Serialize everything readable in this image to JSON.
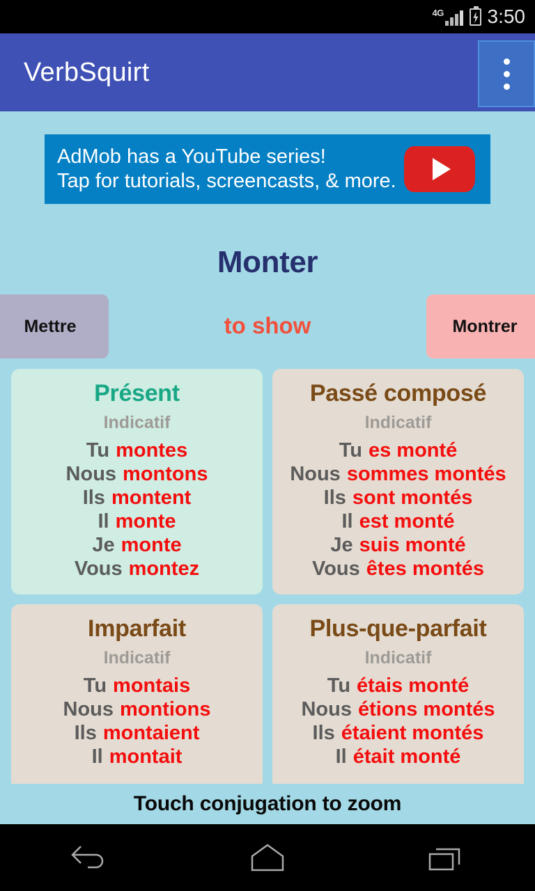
{
  "status_bar": {
    "network": "4G",
    "battery_icon": "battery-charging-icon",
    "time": "3:50"
  },
  "app_bar": {
    "title": "VerbSquirt",
    "overflow_icon": "overflow-menu-icon",
    "background_color": "#3F51B5"
  },
  "ad": {
    "line1": "AdMob has a YouTube series!",
    "line2": "Tap for tutorials, screencasts, & more.",
    "logo_icon": "youtube-play-icon",
    "background_color": "#0580C4"
  },
  "verb": {
    "infinitive": "Monter",
    "translation": "to show",
    "prev_label": "Mettre",
    "next_label": "Montrer",
    "infinitive_color": "#26306E",
    "translation_color": "#F2503C"
  },
  "cards": [
    {
      "title": "Présent",
      "mood": "Indicatif",
      "theme": "mint",
      "title_color": "#18A785",
      "rows": [
        {
          "pronoun": "Tu",
          "form": "montes"
        },
        {
          "pronoun": "Nous",
          "form": "montons"
        },
        {
          "pronoun": "Ils",
          "form": "montent"
        },
        {
          "pronoun": "Il",
          "form": "monte"
        },
        {
          "pronoun": "Je",
          "form": "monte"
        },
        {
          "pronoun": "Vous",
          "form": "montez"
        }
      ]
    },
    {
      "title": "Passé composé",
      "mood": "Indicatif",
      "theme": "beige",
      "title_color": "#7A4A17",
      "rows": [
        {
          "pronoun": "Tu",
          "form": "es monté"
        },
        {
          "pronoun": "Nous",
          "form": "sommes montés"
        },
        {
          "pronoun": "Ils",
          "form": "sont montés"
        },
        {
          "pronoun": "Il",
          "form": "est monté"
        },
        {
          "pronoun": "Je",
          "form": "suis monté"
        },
        {
          "pronoun": "Vous",
          "form": "êtes montés"
        }
      ]
    },
    {
      "title": "Imparfait",
      "mood": "Indicatif",
      "theme": "beige",
      "title_color": "#7A4A17",
      "rows": [
        {
          "pronoun": "Tu",
          "form": "montais"
        },
        {
          "pronoun": "Nous",
          "form": "montions"
        },
        {
          "pronoun": "Ils",
          "form": "montaient"
        },
        {
          "pronoun": "Il",
          "form": "montait"
        }
      ]
    },
    {
      "title": "Plus-que-parfait",
      "mood": "Indicatif",
      "theme": "beige",
      "title_color": "#7A4A17",
      "rows": [
        {
          "pronoun": "Tu",
          "form": "étais monté"
        },
        {
          "pronoun": "Nous",
          "form": "étions montés"
        },
        {
          "pronoun": "Ils",
          "form": "étaient montés"
        },
        {
          "pronoun": "Il",
          "form": "était monté"
        }
      ]
    }
  ],
  "footer": {
    "hint": "Touch conjugation to zoom"
  },
  "nav_bar": {
    "back_icon": "back-arrow-icon",
    "home_icon": "home-icon",
    "recents_icon": "recent-apps-icon"
  },
  "colors": {
    "page_background": "#A3D9E6",
    "verb_form": "#F40E0E",
    "pronoun": "#5C5C5C",
    "mood": "#9E9B97"
  }
}
